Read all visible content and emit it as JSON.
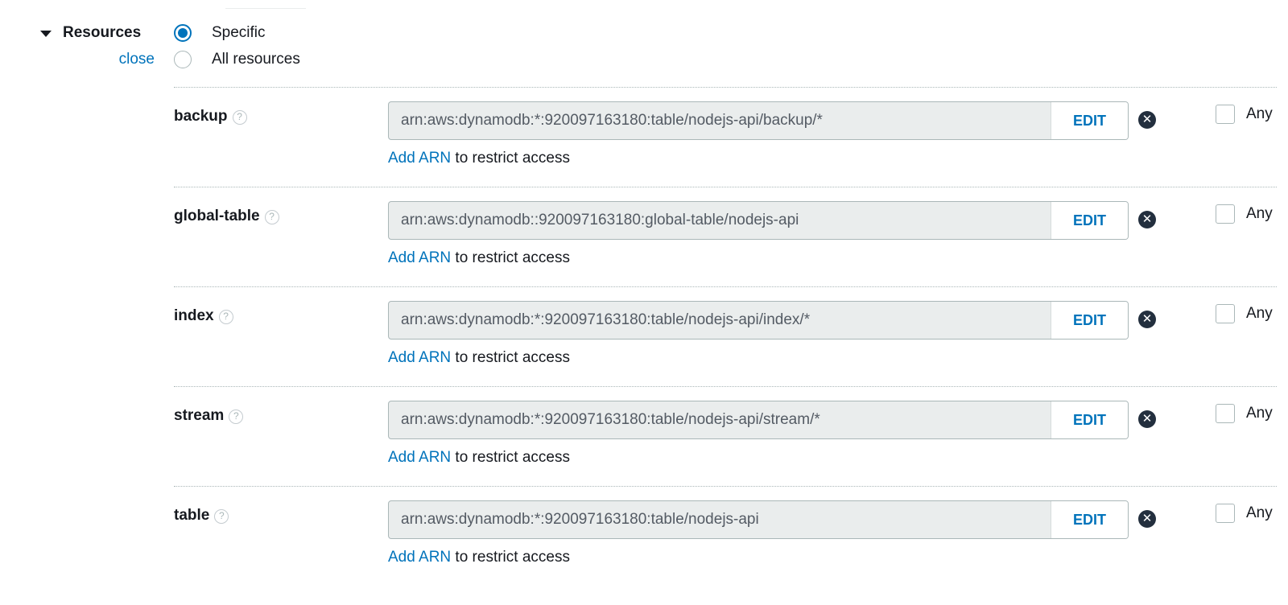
{
  "section": {
    "title": "Resources",
    "close_label": "close"
  },
  "scope_options": [
    {
      "label": "Specific",
      "selected": true
    },
    {
      "label": "All resources",
      "selected": false
    }
  ],
  "resources": [
    {
      "type": "backup",
      "help": "?",
      "arn": "arn:aws:dynamodb:*:920097163180:table/nodejs-api/backup/*",
      "edit_label": "EDIT",
      "add_arn_label": "Add ARN",
      "restrict_text": " to restrict access",
      "any_label": "Any",
      "any_checked": false
    },
    {
      "type": "global-table",
      "help": "?",
      "arn": "arn:aws:dynamodb::920097163180:global-table/nodejs-api",
      "edit_label": "EDIT",
      "add_arn_label": "Add ARN",
      "restrict_text": " to restrict access",
      "any_label": "Any",
      "any_checked": false
    },
    {
      "type": "index",
      "help": "?",
      "arn": "arn:aws:dynamodb:*:920097163180:table/nodejs-api/index/*",
      "edit_label": "EDIT",
      "add_arn_label": "Add ARN",
      "restrict_text": " to restrict access",
      "any_label": "Any",
      "any_checked": false
    },
    {
      "type": "stream",
      "help": "?",
      "arn": "arn:aws:dynamodb:*:920097163180:table/nodejs-api/stream/*",
      "edit_label": "EDIT",
      "add_arn_label": "Add ARN",
      "restrict_text": " to restrict access",
      "any_label": "Any",
      "any_checked": false
    },
    {
      "type": "table",
      "help": "?",
      "arn": "arn:aws:dynamodb:*:920097163180:table/nodejs-api",
      "edit_label": "EDIT",
      "add_arn_label": "Add ARN",
      "restrict_text": " to restrict access",
      "any_label": "Any",
      "any_checked": false
    }
  ],
  "icons": {
    "caret": "caret-down-icon",
    "help": "help-circle-icon",
    "remove": "remove-circle-icon"
  },
  "colors": {
    "link": "#0073bb",
    "text": "#16191f",
    "field_bg": "#eaeded"
  }
}
